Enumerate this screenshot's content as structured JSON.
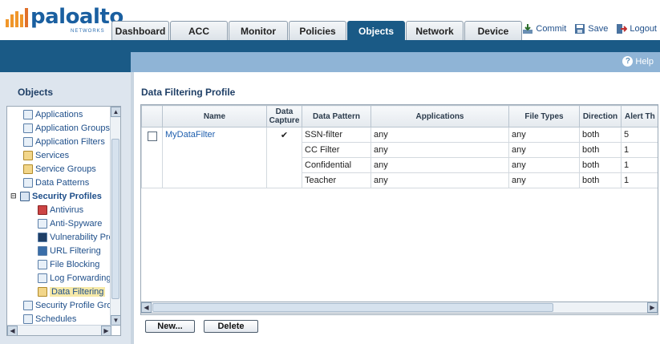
{
  "brand": {
    "name": "paloalto",
    "sub": "NETWORKS"
  },
  "tabs": [
    {
      "label": "Dashboard",
      "active": false
    },
    {
      "label": "ACC",
      "active": false
    },
    {
      "label": "Monitor",
      "active": false
    },
    {
      "label": "Policies",
      "active": false
    },
    {
      "label": "Objects",
      "active": true
    },
    {
      "label": "Network",
      "active": false
    },
    {
      "label": "Device",
      "active": false
    }
  ],
  "toplinks": {
    "commit": "Commit",
    "save": "Save",
    "logout": "Logout"
  },
  "help": "Help",
  "sidebar": {
    "title": "Objects",
    "items": [
      {
        "label": "Applications",
        "icon": "applications-icon"
      },
      {
        "label": "Application Groups",
        "icon": "application-groups-icon"
      },
      {
        "label": "Application Filters",
        "icon": "application-filters-icon"
      },
      {
        "label": "Services",
        "icon": "services-icon"
      },
      {
        "label": "Service Groups",
        "icon": "service-groups-icon"
      },
      {
        "label": "Data Patterns",
        "icon": "data-patterns-icon"
      },
      {
        "label": "Security Profiles",
        "icon": "security-profiles-icon"
      },
      {
        "label": "Antivirus",
        "icon": "antivirus-icon"
      },
      {
        "label": "Anti-Spyware",
        "icon": "anti-spyware-icon"
      },
      {
        "label": "Vulnerability Prote",
        "icon": "vulnerability-icon"
      },
      {
        "label": "URL Filtering",
        "icon": "url-filtering-icon"
      },
      {
        "label": "File Blocking",
        "icon": "file-blocking-icon"
      },
      {
        "label": "Log Forwarding",
        "icon": "log-forwarding-icon"
      },
      {
        "label": "Data Filtering",
        "icon": "data-filtering-icon"
      },
      {
        "label": "Security Profile Group",
        "icon": "security-profile-group-icon"
      },
      {
        "label": "Schedules",
        "icon": "schedules-icon"
      }
    ]
  },
  "main": {
    "title": "Data Filtering Profile",
    "columns": [
      "Name",
      "Data Capture",
      "Data Pattern",
      "Applications",
      "File Types",
      "Direction",
      "Alert Th"
    ],
    "profile": {
      "name": "MyDataFilter",
      "data_capture": "✔"
    },
    "rows": [
      {
        "pattern": "SSN-filter",
        "applications": "any",
        "file_types": "any",
        "direction": "both",
        "alert": "5"
      },
      {
        "pattern": "CC Filter",
        "applications": "any",
        "file_types": "any",
        "direction": "both",
        "alert": "1"
      },
      {
        "pattern": "Confidential",
        "applications": "any",
        "file_types": "any",
        "direction": "both",
        "alert": "1"
      },
      {
        "pattern": "Teacher",
        "applications": "any",
        "file_types": "any",
        "direction": "both",
        "alert": "1"
      }
    ],
    "buttons": {
      "new": "New...",
      "delete": "Delete"
    }
  },
  "colors": {
    "accent": "#1a5a86",
    "helpbar": "#8fb4d6",
    "panel": "#dde5ee",
    "link": "#1f5fae"
  }
}
